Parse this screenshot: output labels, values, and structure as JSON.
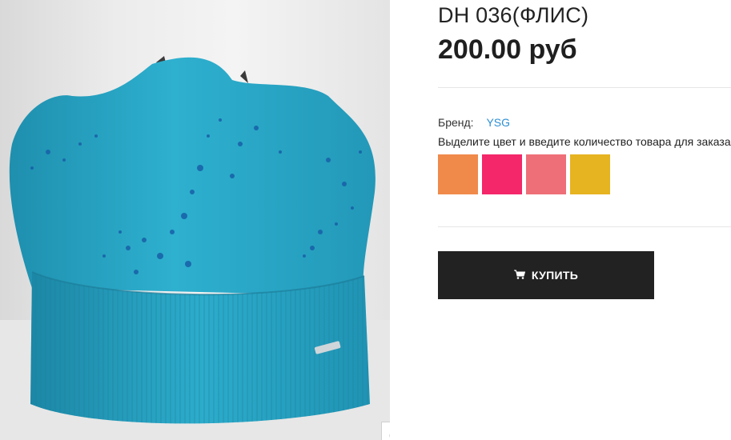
{
  "product": {
    "title": "DH 036(ФЛИС)",
    "price": "200.00 руб",
    "brand_label": "Бренд:",
    "brand_value": "YSG",
    "instruction": "Выделите цвет и введите количество товара для заказа",
    "colors": [
      {
        "name": "orange",
        "hex": "#f08a4b"
      },
      {
        "name": "hot-pink",
        "hex": "#f4276a"
      },
      {
        "name": "salmon-pink",
        "hex": "#ee6f78"
      },
      {
        "name": "mustard",
        "hex": "#e6b321"
      }
    ],
    "buy_label": "КУПИТЬ",
    "buy_icon": "cart-icon"
  },
  "photo": {
    "icon": "zoom-icon"
  },
  "colors": {
    "hat": "#2aa7c4",
    "link": "#2d8fd5",
    "button": "#222222"
  }
}
